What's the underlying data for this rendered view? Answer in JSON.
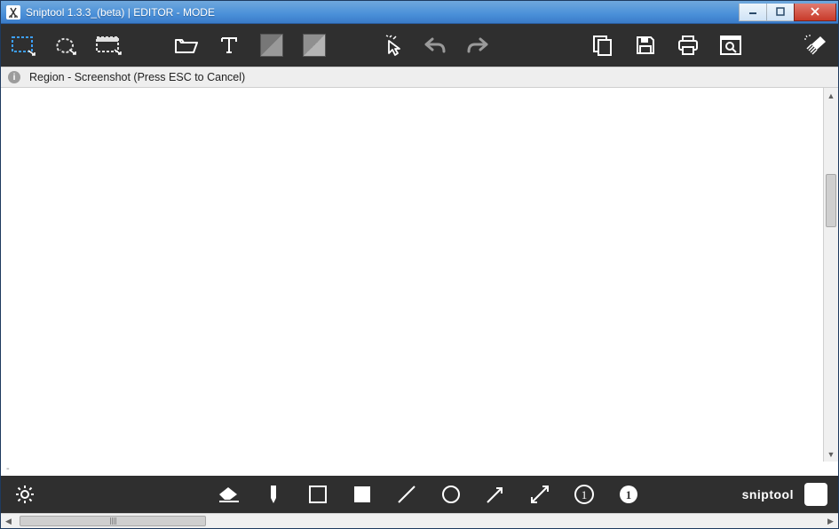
{
  "titlebar": {
    "title": "Sniptool 1.3.3_(beta)  |  EDITOR - MODE"
  },
  "toolbar": {
    "region_capture": "Region Capture",
    "freehand_capture": "Freehand Capture",
    "window_capture": "Window Capture",
    "open": "Open",
    "text_tool": "Text",
    "fg_color": "#808080",
    "bg_color": "#a0a0a0",
    "pointer": "Pointer",
    "undo": "Undo",
    "redo": "Redo",
    "copy": "Copy",
    "save": "Save",
    "print": "Print",
    "search": "Search",
    "clear": "Clear"
  },
  "infobar": {
    "message": "Region - Screenshot (Press ESC to Cancel)"
  },
  "status": {
    "left": "-"
  },
  "bottombar": {
    "settings": "Settings",
    "eraser": "Eraser",
    "highlighter": "Highlighter",
    "rect_outline": "Rectangle Outline",
    "rect_fill": "Rectangle Fill",
    "line": "Line",
    "circle": "Circle",
    "arrow": "Arrow",
    "double_arrow": "Double Arrow",
    "number_outline": "Number Stamp Outline",
    "number_fill": "Number Stamp Fill",
    "number_value": "1",
    "brand": "sniptool"
  }
}
